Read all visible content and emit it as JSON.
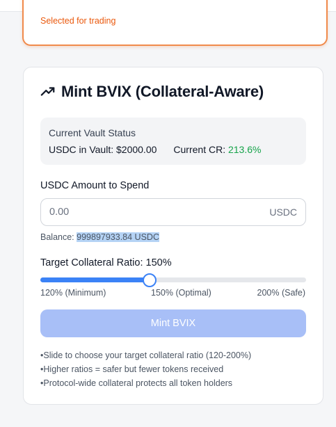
{
  "selected_card": {
    "status_text": "Selected for trading"
  },
  "mint_card": {
    "title": "Mint BVIX (Collateral-Aware)",
    "icon": "trending-up-icon",
    "vault_status": {
      "heading": "Current Vault Status",
      "usdc_label": "USDC in Vault:",
      "usdc_value": "$2000.00",
      "cr_label": "Current CR:",
      "cr_value": "213.6%",
      "cr_color": "#16a34a"
    },
    "amount": {
      "label": "USDC Amount to Spend",
      "placeholder": "0.00",
      "value": "",
      "unit": "USDC"
    },
    "balance": {
      "label": "Balance:",
      "value": "999897933.84 USDC"
    },
    "collateral_ratio": {
      "label": "Target Collateral Ratio: 150%",
      "min": 120,
      "max": 200,
      "value": 150,
      "ticks": [
        "120% (Minimum)",
        "150% (Optimal)",
        "200% (Safe)"
      ]
    },
    "mint_button_label": "Mint BVIX",
    "notes": [
      "Slide to choose your target collateral ratio (120-200%)",
      "Higher ratios = safer but fewer tokens received",
      "Protocol-wide collateral protects all token holders"
    ]
  },
  "colors": {
    "accent": "#3b82f6",
    "selected_border": "#f08a4b",
    "selected_text": "#ea580c",
    "button_disabled": "#a8bff7"
  }
}
